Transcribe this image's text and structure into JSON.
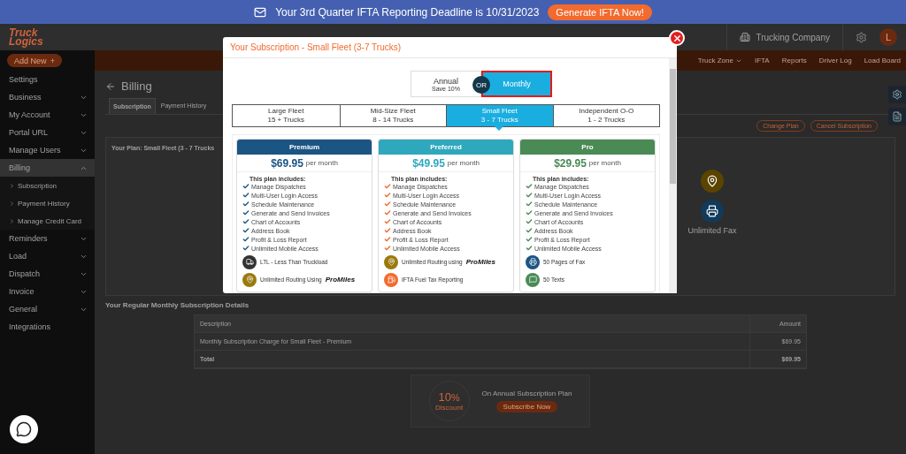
{
  "banner": {
    "message": "Your 3rd Quarter IFTA Reporting Deadline is 10/31/2023",
    "button": "Generate IFTA Now!"
  },
  "header": {
    "logo_top": "Truck",
    "logo_bottom": "Logics",
    "company": "Trucking Company",
    "avatar": "L"
  },
  "nav": {
    "add_new": "Add New",
    "add_icon": "+",
    "items": [
      {
        "label": "Truck Zone",
        "dropdown": true
      },
      {
        "label": "IFTA",
        "dropdown": false
      },
      {
        "label": "Reports",
        "dropdown": false
      },
      {
        "label": "Driver Log",
        "dropdown": false
      },
      {
        "label": "Load Board",
        "dropdown": false
      }
    ]
  },
  "sidebar": {
    "items": [
      {
        "label": "Settings",
        "expandable": false,
        "expanded": false
      },
      {
        "label": "Business",
        "expandable": true,
        "expanded": false
      },
      {
        "label": "My Account",
        "expandable": true,
        "expanded": false
      },
      {
        "label": "Portal URL",
        "expandable": true,
        "expanded": false
      },
      {
        "label": "Manage Users",
        "expandable": true,
        "expanded": false
      },
      {
        "label": "Billing",
        "expandable": true,
        "expanded": true,
        "children": [
          {
            "label": "Subscription"
          },
          {
            "label": "Payment History"
          },
          {
            "label": "Manage Credit Card"
          }
        ]
      },
      {
        "label": "Reminders",
        "expandable": true,
        "expanded": false
      },
      {
        "label": "Load",
        "expandable": true,
        "expanded": false
      },
      {
        "label": "Dispatch",
        "expandable": true,
        "expanded": false
      },
      {
        "label": "Invoice",
        "expandable": true,
        "expanded": false
      },
      {
        "label": "General",
        "expandable": true,
        "expanded": false
      },
      {
        "label": "Integrations",
        "expandable": false,
        "expanded": false
      }
    ]
  },
  "billing": {
    "title": "Billing",
    "tabs": [
      {
        "label": "Subscription",
        "selected": true
      },
      {
        "label": "Payment History",
        "selected": false
      }
    ],
    "actions": [
      "Change Plan",
      "Cancel Subscription"
    ],
    "plan_title": "Your Plan: Small Fleet (3 - 7 Trucks",
    "feature": "Unlimited Fax",
    "details_title": "Your Regular Monthly Subscription Details",
    "table": {
      "columns": [
        "Description",
        "Amount"
      ],
      "rows": [
        [
          "Monthly Subscription Charge for Small Fleet - Premium",
          "$69.95"
        ]
      ],
      "total": [
        "Total",
        "$69.95"
      ]
    },
    "promo": {
      "percent": "10",
      "unit": "%",
      "label": "Discount",
      "text": "On Annual Subscription Plan",
      "button": "Subscribe Now"
    }
  },
  "modal": {
    "title": "Your Subscription - Small Fleet (3-7 Trucks)",
    "billing_options": [
      {
        "label": "Annual",
        "note": "Save 10%",
        "selected": false
      },
      {
        "label": "Monthly",
        "selected": true
      }
    ],
    "or": "OR",
    "fleets": [
      {
        "name": "Large Fleet",
        "trucks": "15 + Trucks",
        "selected": false
      },
      {
        "name": "Mid-Size Fleet",
        "trucks": "8 - 14 Trucks",
        "selected": false
      },
      {
        "name": "Small Fleet",
        "trucks": "3 - 7 Trucks",
        "selected": true
      },
      {
        "name": "Independent O-O",
        "trucks": "1 - 2 Trucks",
        "selected": false
      }
    ],
    "plans": [
      {
        "name": "Premium",
        "color": "#1b5583",
        "price": "$69.95",
        "period": "per month",
        "includes": "This plan includes:",
        "features": [
          "Manage Dispatches",
          "Multi-User Login Access",
          "Schedule Maintenance",
          "Generate and Send Invoices",
          "Chart of Accounts",
          "Address Book",
          "Profit & Loss Report",
          "Unlimited Mobile Access"
        ],
        "extras": [
          {
            "kind": "truck",
            "text": "LTL - Less Than Truckload"
          },
          {
            "kind": "pin",
            "text": "Unlimited Routing Using",
            "brand": "ProMiles"
          }
        ]
      },
      {
        "name": "Preferred",
        "color": "#2fa8bd",
        "price": "$49.95",
        "period": "per month",
        "includes": "This plan includes:",
        "features": [
          "Manage Dispatches",
          "Multi-User Login Access",
          "Schedule Maintenance",
          "Generate and Send Invoices",
          "Chart of Accounts",
          "Address Book",
          "Profit & Loss Report",
          "Unlimited Mobile Access"
        ],
        "extras": [
          {
            "kind": "pin",
            "text": "Unlimited Routing using",
            "brand": "ProMiles"
          },
          {
            "kind": "fuel",
            "text": "IFTA Fuel Tax Reporting"
          }
        ]
      },
      {
        "name": "Pro",
        "color": "#4a8a55",
        "price": "$29.95",
        "period": "per month",
        "includes": "This plan includes:",
        "features": [
          "Manage Dispatches",
          "Multi-User Login Access",
          "Schedule Maintenance",
          "Generate and Send Invoices",
          "Chart of Accounts",
          "Address Book",
          "Profit & Loss Report",
          "Unlimited Mobile Access"
        ],
        "extras": [
          {
            "kind": "fax",
            "text": "50 Pages of Fax"
          },
          {
            "kind": "chat",
            "text": "50 Texts"
          }
        ]
      }
    ]
  }
}
